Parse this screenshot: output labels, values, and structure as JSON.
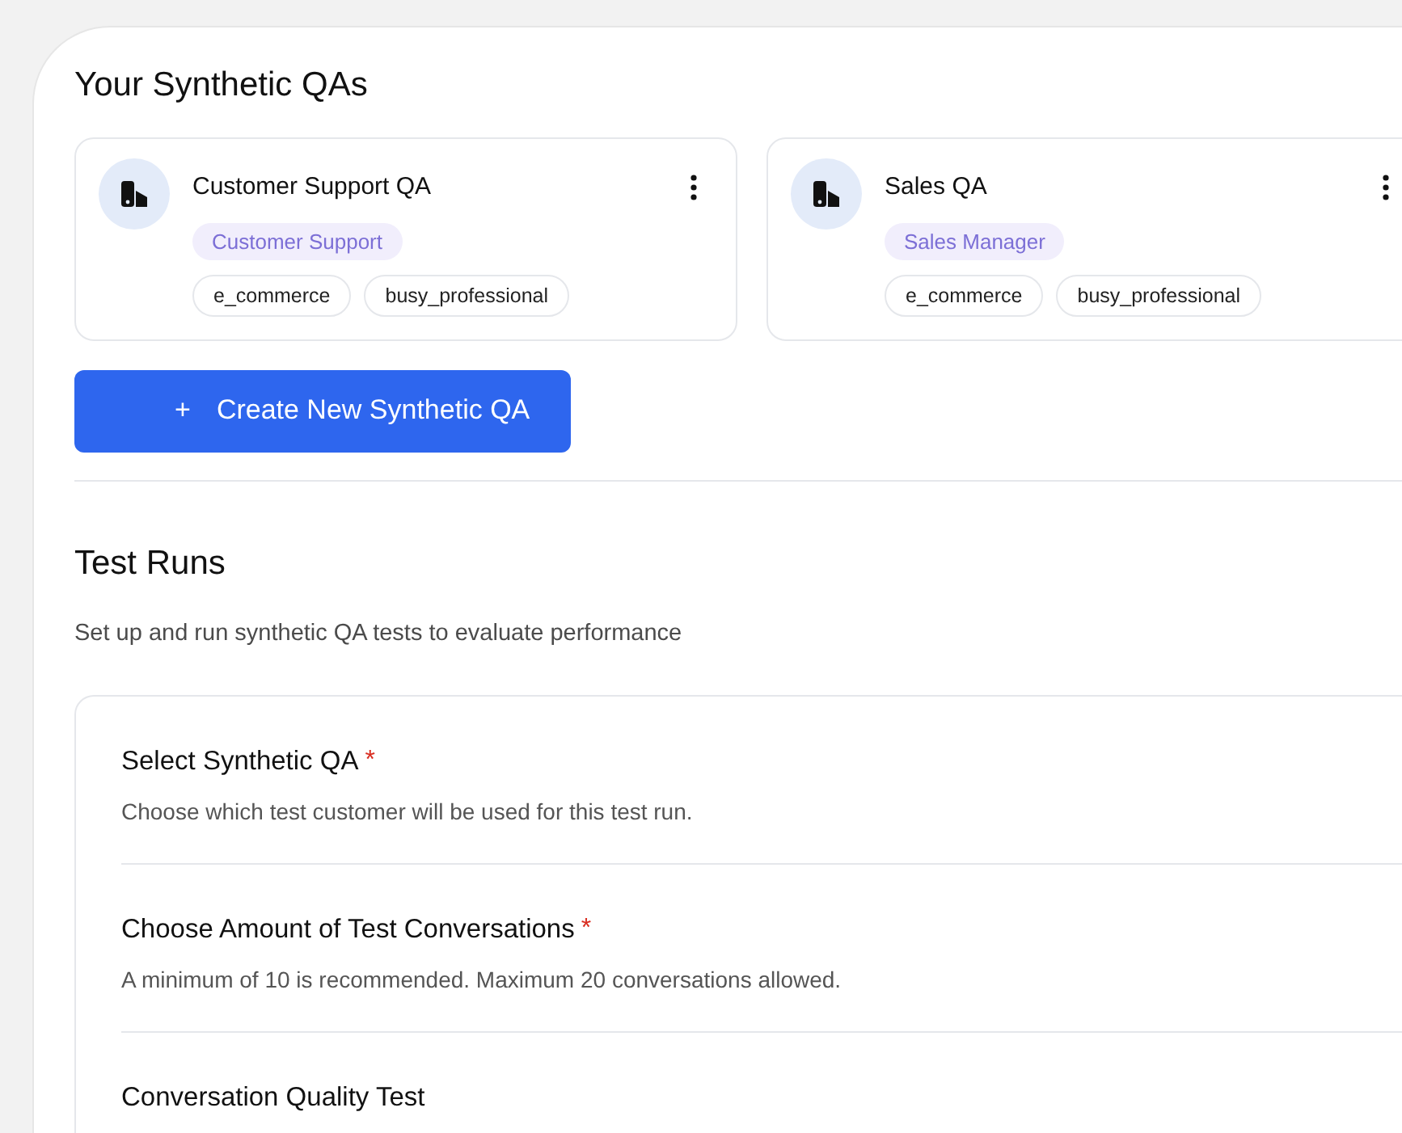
{
  "qas_section": {
    "title": "Your Synthetic QAs",
    "cards": [
      {
        "name": "Customer Support QA",
        "role": "Customer Support",
        "tags": [
          "e_commerce",
          "busy_professional"
        ]
      },
      {
        "name": "Sales QA",
        "role": "Sales Manager",
        "tags": [
          "e_commerce",
          "busy_professional"
        ]
      }
    ],
    "create_button": {
      "icon": "+",
      "label": "Create New Synthetic QA"
    }
  },
  "test_runs": {
    "title": "Test Runs",
    "subtitle": "Set up and run synthetic QA tests to evaluate performance",
    "fields": [
      {
        "label": "Select Synthetic QA",
        "required": true,
        "required_mark": "*",
        "hint": "Choose which test customer will be used for this test run."
      },
      {
        "label": "Choose Amount of Test Conversations",
        "required": true,
        "required_mark": "*",
        "hint": "A minimum of 10 is recommended. Maximum 20 conversations allowed."
      },
      {
        "label": "Conversation Quality Test"
      }
    ]
  }
}
